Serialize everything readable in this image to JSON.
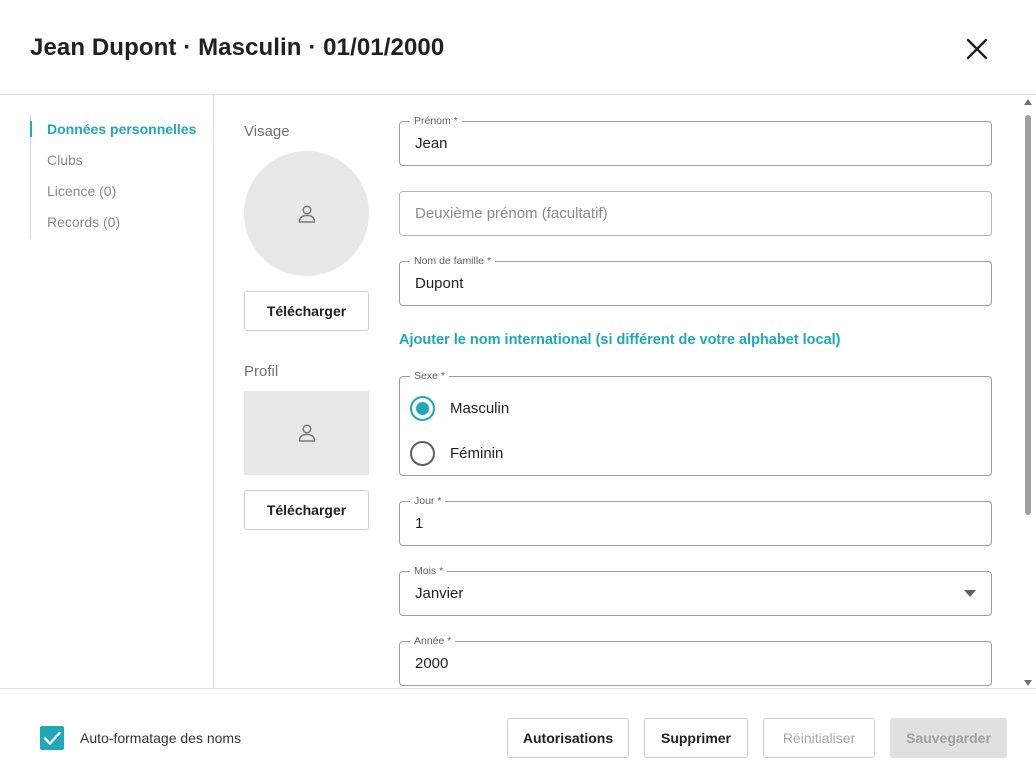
{
  "dialog": {
    "title": "Jean Dupont · Masculin · 01/01/2000"
  },
  "nav": {
    "items": [
      {
        "label": "Données personnelles",
        "active": true
      },
      {
        "label": "Clubs",
        "active": false
      },
      {
        "label": "Licence (0)",
        "active": false
      },
      {
        "label": "Records (0)",
        "active": false
      }
    ]
  },
  "images": {
    "face_label": "Visage",
    "profile_label": "Profil",
    "upload_label": "Télécharger"
  },
  "form": {
    "first_name": {
      "label": "Prénom  *",
      "value": "Jean"
    },
    "middle_name": {
      "placeholder": "Deuxième prénom (facultatif)",
      "value": ""
    },
    "last_name": {
      "label": "Nom de famille  *",
      "value": "Dupont"
    },
    "intl_link": "Ajouter le nom international (si différent de votre alphabet local)",
    "sex": {
      "label": "Sexe  *",
      "options": [
        {
          "label": "Masculin",
          "checked": true
        },
        {
          "label": "Féminin",
          "checked": false
        }
      ]
    },
    "day": {
      "label": "Jour *",
      "value": "1"
    },
    "month": {
      "label": "Mois *",
      "value": "Janvier"
    },
    "year": {
      "label": "Année *",
      "value": "2000"
    }
  },
  "footer": {
    "autoformat_label": "Auto-formatage des noms",
    "autoformat_checked": true,
    "buttons": {
      "permissions": "Autorisations",
      "delete": "Supprimer",
      "reset": "Réinitialiser",
      "save": "Sauvegarder"
    }
  },
  "colors": {
    "accent": "#1fa8b8",
    "border": "#9e9e9e",
    "disabled_bg": "#e0e0e0"
  },
  "icons": [
    "close-icon",
    "person-icon",
    "check-icon",
    "chevron-down-icon",
    "scroll-up-arrow",
    "scroll-down-arrow"
  ]
}
